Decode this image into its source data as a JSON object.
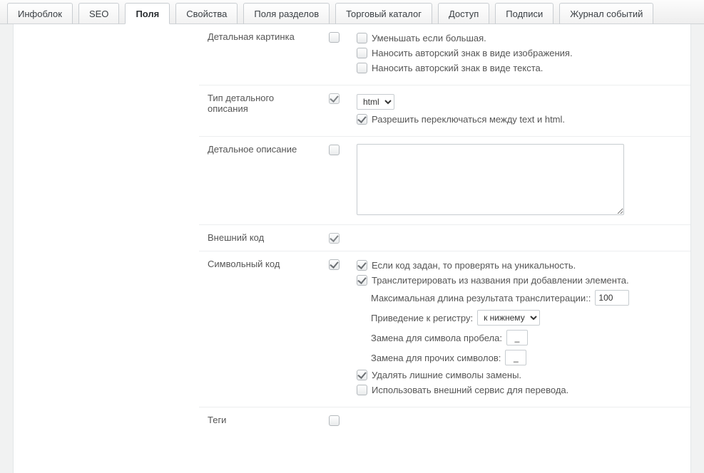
{
  "tabs": {
    "infoblock": "Инфоблок",
    "seo": "SEO",
    "fields": "Поля",
    "properties": "Свойства",
    "section_fields": "Поля разделов",
    "catalog": "Торговый каталог",
    "access": "Доступ",
    "captions": "Подписи",
    "event_log": "Журнал событий"
  },
  "rows": {
    "detail_picture": {
      "label": "Детальная картинка",
      "opt_shrink": "Уменьшать если большая.",
      "opt_watermark_img": "Наносить авторский знак в виде изображения.",
      "opt_watermark_text": "Наносить авторский знак в виде текста."
    },
    "detail_text_type": {
      "label": "Тип детального описания",
      "select_value": "html",
      "allow_switch": "Разрешить переключаться между text и html."
    },
    "detail_text": {
      "label": "Детальное описание",
      "value": ""
    },
    "external_code": {
      "label": "Внешний код"
    },
    "symbol_code": {
      "label": "Символьный код",
      "opt_unique": "Если код задан, то проверять на уникальность.",
      "opt_translit": "Транслитерировать из названия при добавлении элемента.",
      "maxlen_label": "Максимальная длина результата транслитерации::",
      "maxlen_value": "100",
      "case_label": "Приведение к регистру:",
      "case_value": "к нижнему",
      "space_label": "Замена для символа пробела:",
      "space_value": "_",
      "other_label": "Замена для прочих символов:",
      "other_value": "_",
      "opt_trim": "Удалять лишние символы замены.",
      "opt_external": "Использовать внешний сервис для перевода."
    },
    "tags": {
      "label": "Теги"
    }
  }
}
